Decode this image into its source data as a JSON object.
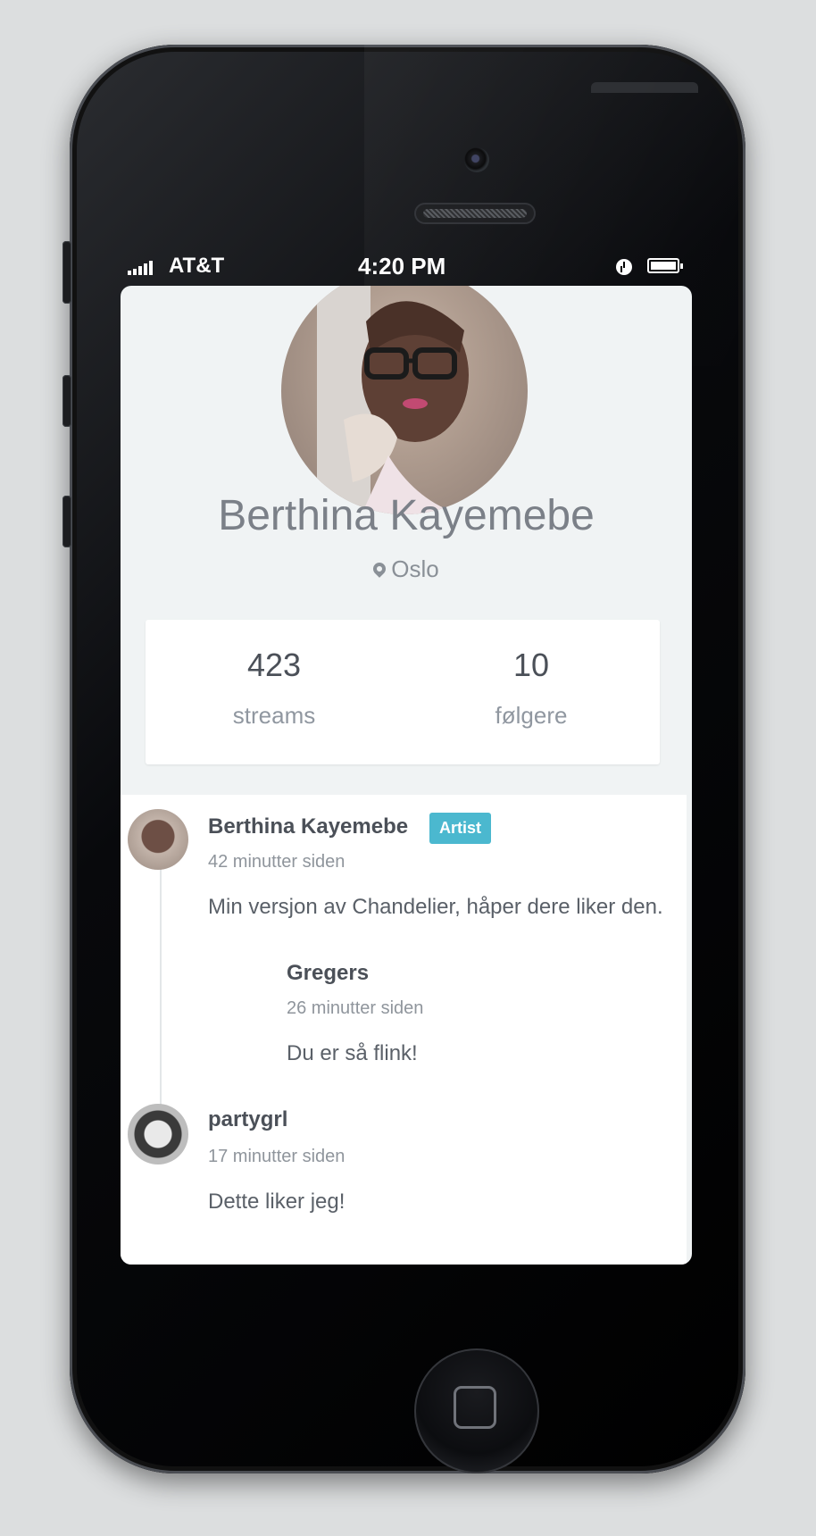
{
  "status_bar": {
    "carrier": "AT&T",
    "time": "4:20 PM"
  },
  "profile": {
    "name": "Berthina Kayemebe",
    "location": "Oslo",
    "stats": [
      {
        "value": "423",
        "label": "streams"
      },
      {
        "value": "10",
        "label": "følgere"
      }
    ]
  },
  "feed": {
    "posts": [
      {
        "author": "Berthina Kayemebe",
        "badge": "Artist",
        "time": "42 minutter siden",
        "text": "Min versjon av Chandelier, håper dere liker den.",
        "replies": [
          {
            "author": "Gregers",
            "time": "26 minutter siden",
            "text": "Du er så flink!"
          }
        ]
      },
      {
        "author": "partygrl",
        "time": "17 minutter siden",
        "text": "Dette liker jeg!"
      }
    ]
  },
  "icons": {
    "signal": "signal-bars-icon",
    "clock": "clock-icon",
    "battery": "battery-icon",
    "location": "map-pin-icon",
    "home": "home-button-icon"
  }
}
